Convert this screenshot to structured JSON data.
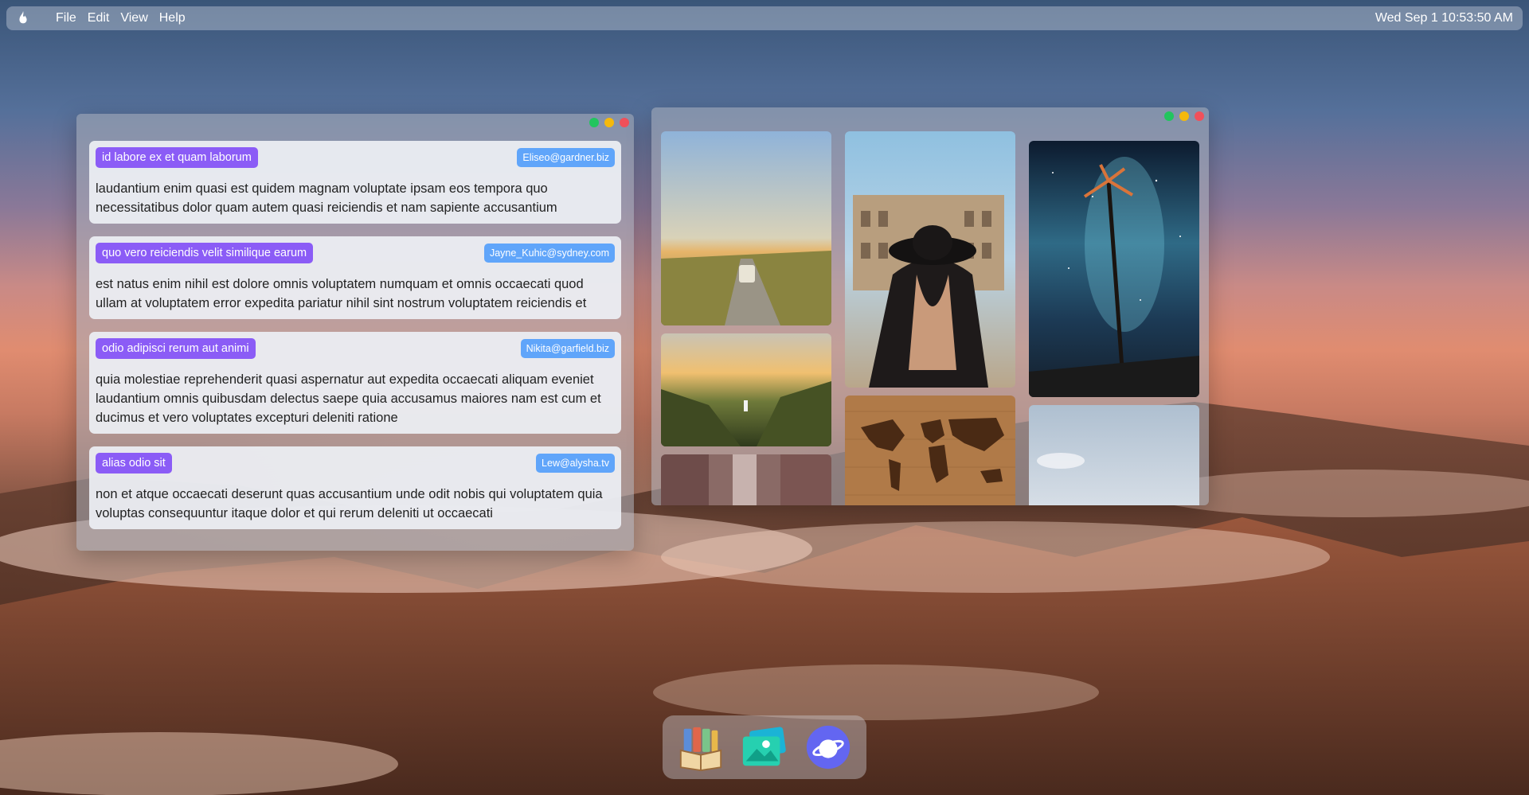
{
  "menubar": {
    "logo_icon": "flame-icon",
    "menus": [
      "File",
      "Edit",
      "View",
      "Help"
    ],
    "clock": "Wed Sep 1 10:53:50 AM"
  },
  "notes_window": {
    "cards": [
      {
        "title": "id labore ex et quam laborum",
        "email": "Eliseo@gardner.biz",
        "body": "laudantium enim quasi est quidem magnam voluptate ipsam eos tempora quo necessitatibus dolor quam autem quasi reiciendis et nam sapiente accusantium"
      },
      {
        "title": "quo vero reiciendis velit similique earum",
        "email": "Jayne_Kuhic@sydney.com",
        "body": "est natus enim nihil est dolore omnis voluptatem numquam et omnis occaecati quod ullam at voluptatem error expedita pariatur nihil sint nostrum voluptatem reiciendis et"
      },
      {
        "title": "odio adipisci rerum aut animi",
        "email": "Nikita@garfield.biz",
        "body": "quia molestiae reprehenderit quasi aspernatur aut expedita occaecati aliquam eveniet laudantium omnis quibusdam delectus saepe quia accusamus maiores nam est cum et ducimus et vero voluptates excepturi deleniti ratione"
      },
      {
        "title": "alias odio sit",
        "email": "Lew@alysha.tv",
        "body": "non et atque occaecati deserunt quas accusantium unde odit nobis qui voluptatem quia voluptas consequuntur itaque dolor et qui rerum deleniti ut occaecati"
      }
    ]
  },
  "photos_window": {
    "photos": [
      "road-trip-van-photo",
      "colosseum-traveler-photo",
      "starry-palm-tree-photo",
      "valley-hiker-photo",
      "world-map-wood-photo",
      "city-street-photo",
      "sky-clouds-photo"
    ]
  },
  "dock": {
    "apps": [
      "books-icon",
      "photos-icon",
      "browser-icon"
    ]
  },
  "colors": {
    "title_tag": "#8b5cf6",
    "email_tag": "#60a5fa",
    "close": "#f0505a",
    "minimize": "#f5b90b",
    "maximize": "#22c55e"
  }
}
